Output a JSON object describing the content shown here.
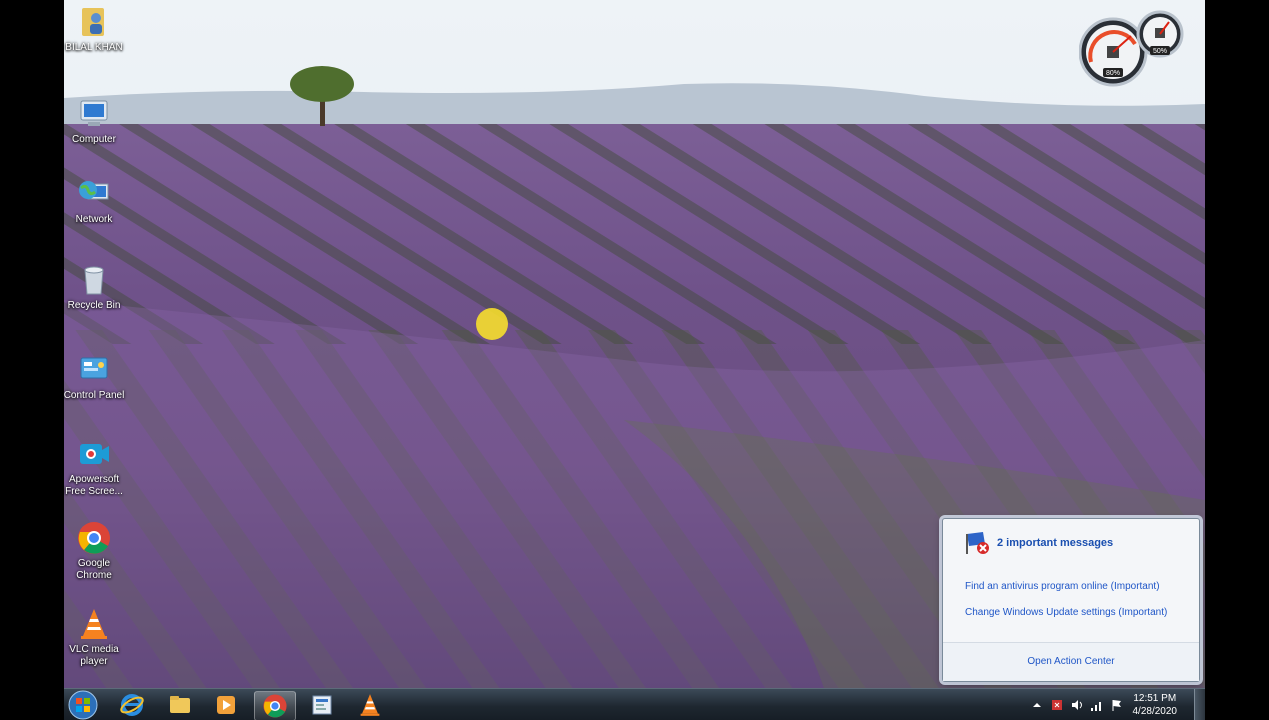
{
  "desktop": {
    "icons": [
      {
        "label": "BILAL KHAN",
        "icon": "user-folder-icon"
      },
      {
        "label": "Computer",
        "icon": "computer-icon"
      },
      {
        "label": "Network",
        "icon": "network-icon"
      },
      {
        "label": "Recycle Bin",
        "icon": "recycle-bin-icon"
      },
      {
        "label": "Control Panel",
        "icon": "control-panel-icon"
      },
      {
        "label": "Apowersoft Free Scree...",
        "icon": "apowersoft-icon"
      },
      {
        "label": "Google Chrome",
        "icon": "chrome-icon"
      },
      {
        "label": "VLC media player",
        "icon": "vlc-icon"
      }
    ]
  },
  "gadget": {
    "cpu_percent": "80%",
    "memory_percent": "50%"
  },
  "notification": {
    "header": "2 important messages",
    "items": [
      "Find an antivirus program online (Important)",
      "Change Windows Update settings (Important)"
    ],
    "footer": "Open Action Center"
  },
  "taskbar": {
    "pinned": [
      "start-orb-icon",
      "internet-explorer-icon",
      "file-explorer-icon",
      "media-player-icon",
      "chrome-icon",
      "contacts-icon",
      "vlc-icon"
    ],
    "active_index": 4,
    "clock_time": "12:51 PM",
    "clock_date": "4/28/2020"
  },
  "colors": {
    "sky": "#e6eef4",
    "lavender": "#7a5b94",
    "link": "#1f56c7"
  }
}
